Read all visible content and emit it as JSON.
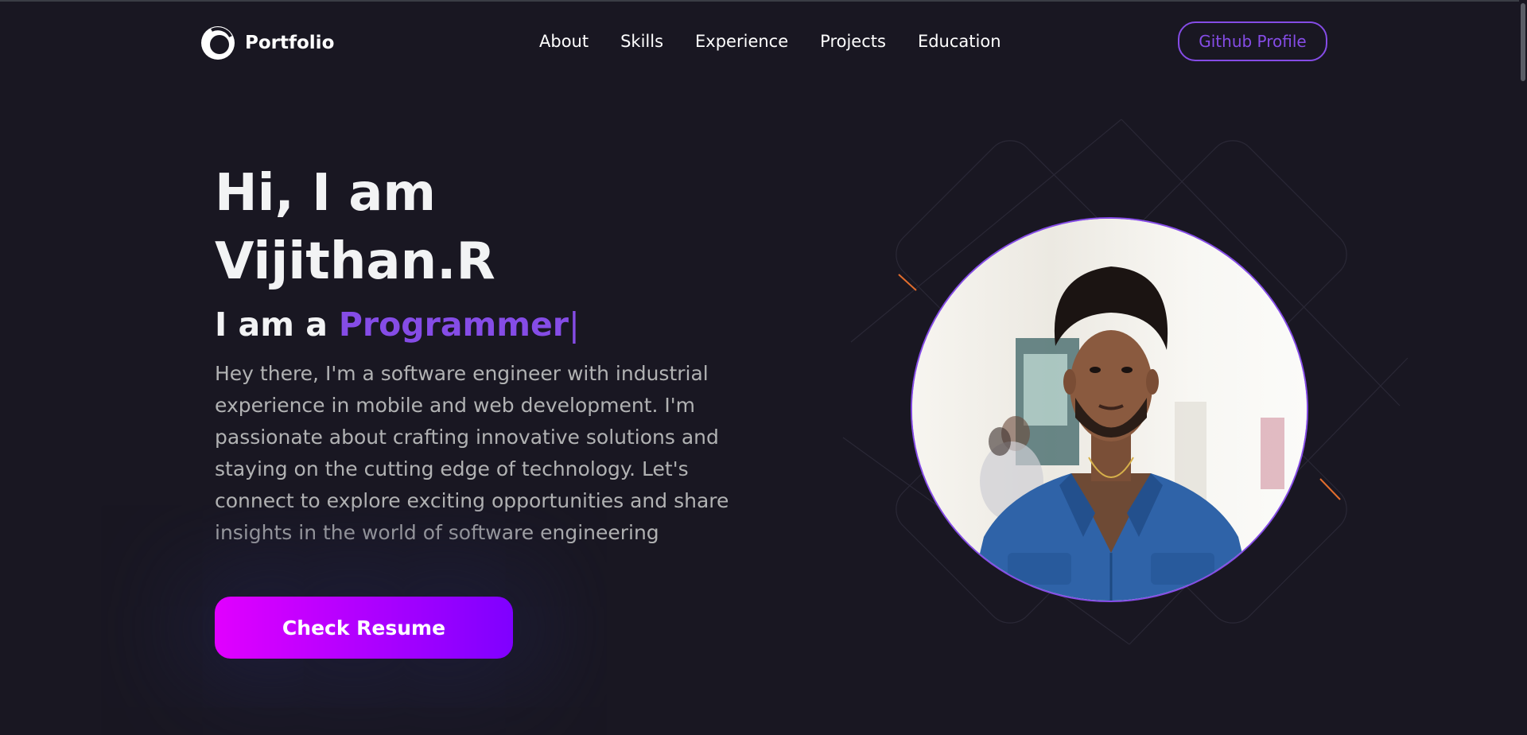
{
  "logo": {
    "text": "Portfolio",
    "icon": "portfolio-logo-icon"
  },
  "nav": {
    "links": [
      "About",
      "Skills",
      "Experience",
      "Projects",
      "Education"
    ],
    "github_label": "Github Profile"
  },
  "hero": {
    "title_line1": "Hi, I am",
    "title_line2": "Vijithan.R",
    "role_prefix": "I am a",
    "role_word": "Programmer",
    "caret": "|",
    "description": "Hey there, I'm a software engineer with industrial experience in mobile and web development. I'm passionate about crafting innovative solutions and staying on the cutting edge of technology. Let's connect to explore exciting opportunities and share insights in the world of software engineering",
    "resume_label": "Check Resume"
  },
  "colors": {
    "background": "#191722",
    "primary": "#854ce6",
    "text": "#f2f3f4",
    "text_secondary": "#b1b2b3",
    "button_gradient_start": "#e100ff",
    "button_gradient_end": "#7f00ff"
  }
}
